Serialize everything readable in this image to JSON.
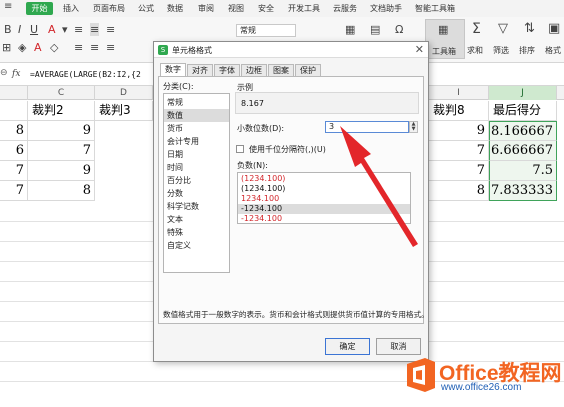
{
  "menu": {
    "start": "开始",
    "items": [
      "插入",
      "页面布局",
      "公式",
      "数据",
      "审阅",
      "视图",
      "安全",
      "开发工具",
      "云服务",
      "文档助手",
      "智能工具箱"
    ]
  },
  "ribbon": {
    "font_value": "常规",
    "toolbox_label": "工具箱",
    "sum_label": "求和",
    "filter_label": "筛选",
    "sort_label": "排序",
    "format_label": "格式"
  },
  "formula_bar": {
    "fx": "fx",
    "formula": "=AVERAGE(LARGE(B2:I2,{2"
  },
  "grid": {
    "columns": [
      "C",
      "D",
      "I",
      "J"
    ],
    "header_row": [
      "裁判2",
      "裁判3",
      "裁判8",
      "最后得分"
    ],
    "rows": [
      {
        "left": "8",
        "c": "9",
        "i": "9",
        "j": "8.166667"
      },
      {
        "left": "6",
        "c": "7",
        "i": "7",
        "j": "6.666667"
      },
      {
        "left": "7",
        "c": "9",
        "i": "7",
        "j": "7.5"
      },
      {
        "left": "7",
        "c": "8",
        "i": "8",
        "j": "7.833333"
      }
    ]
  },
  "dialog": {
    "title": "单元格格式",
    "close": "✕",
    "tabs": [
      "数字",
      "对齐",
      "字体",
      "边框",
      "图案",
      "保护"
    ],
    "active_tab": "数字",
    "category_label": "分类(C):",
    "categories": [
      "常规",
      "数值",
      "货币",
      "会计专用",
      "日期",
      "时间",
      "百分比",
      "分数",
      "科学记数",
      "文本",
      "特殊",
      "自定义"
    ],
    "selected_category": "数值",
    "sample_label": "示例",
    "sample_value": "8.167",
    "decimals_label": "小数位数(D):",
    "decimals_value": "3",
    "thousand_sep_label": "使用千位分隔符(,)(U)",
    "negative_label": "负数(N):",
    "negatives": [
      {
        "text": "(1234.100)",
        "color": "#d2262b"
      },
      {
        "text": "(1234.100)",
        "color": "#111111"
      },
      {
        "text": "1234.100",
        "color": "#d2262b"
      },
      {
        "text": "-1234.100",
        "color": "#111111"
      },
      {
        "text": "-1234.100",
        "color": "#d2262b"
      }
    ],
    "description": "数值格式用于一般数字的表示。货币和会计格式则提供货币值计算的专用格式。",
    "ok_label": "确定",
    "cancel_label": "取消"
  },
  "watermark": {
    "main": "Office教程网",
    "sub": "www.office26.com"
  },
  "colors": {
    "accent_green": "#2fa84f",
    "arrow_red": "#e3262a",
    "logo_orange": "#f26522",
    "logo_blue": "#1f5fb5"
  }
}
